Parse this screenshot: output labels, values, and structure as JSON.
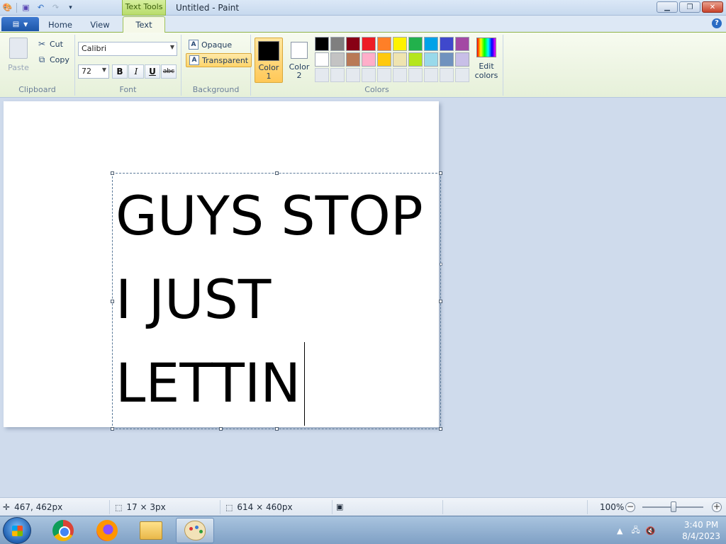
{
  "titlebar": {
    "title": "Untitled - Paint",
    "context_tab": "Text Tools"
  },
  "tabs": [
    {
      "label": "Home"
    },
    {
      "label": "View"
    },
    {
      "label": "Text"
    }
  ],
  "ribbon": {
    "clipboard": {
      "paste": "Paste",
      "cut": "Cut",
      "copy": "Copy",
      "group_label": "Clipboard"
    },
    "font": {
      "family": "Calibri",
      "size": "72",
      "bold": "B",
      "italic": "I",
      "underline": "U",
      "strikethrough": "abc",
      "group_label": "Font"
    },
    "background": {
      "opaque": "Opaque",
      "transparent": "Transparent",
      "selected": "Transparent",
      "group_label": "Background"
    },
    "colors": {
      "color1_label_a": "Color",
      "color1_label_b": "1",
      "color2_label_a": "Color",
      "color2_label_b": "2",
      "color1": "#000000",
      "color2": "#ffffff",
      "edit_a": "Edit",
      "edit_b": "colors",
      "group_label": "Colors",
      "palette_row1": [
        "#000000",
        "#7f7f7f",
        "#880015",
        "#ed1c24",
        "#ff7f27",
        "#fff200",
        "#22b14c",
        "#00a2e8",
        "#3f48cc",
        "#a349a4"
      ],
      "palette_row2": [
        "#ffffff",
        "#c3c3c3",
        "#b97a57",
        "#ffaec9",
        "#ffc90e",
        "#efe4b0",
        "#b5e61d",
        "#99d9ea",
        "#7092be",
        "#c8bfe7"
      ]
    }
  },
  "canvas": {
    "text_lines": [
      "GUYS STOP",
      "I JUST",
      "LETTIN"
    ]
  },
  "statusbar": {
    "cursor_pos": "467, 462px",
    "selection_size": "17 × 3px",
    "image_size": "614 × 460px",
    "zoom": "100%",
    "zoom_minus": "−",
    "zoom_plus": "+"
  },
  "taskbar": {
    "time": "3:40 PM",
    "date": "8/4/2023"
  }
}
